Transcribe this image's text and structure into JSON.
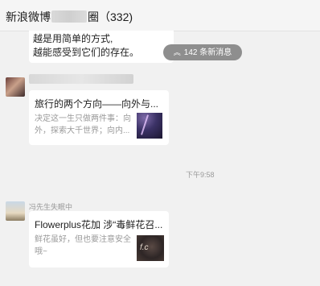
{
  "header": {
    "title_prefix": "新浪微博",
    "title_suffix": "圈（332)"
  },
  "previous_message": {
    "line1": "越是用简单的方式,",
    "line2": "越能感受到它们的存在。"
  },
  "new_messages": {
    "icon": "double-chevron-up-icon",
    "label": "142 条新消息"
  },
  "messages": [
    {
      "card_title": "旅行的两个方向——向外与...",
      "card_desc": [
        "决定这一生只做两件事：向",
        "外，探索大千世界；向内..."
      ]
    },
    {
      "sender": "冯先生失眠中",
      "card_title": "Flowerplus花加 涉“毒鲜花召...",
      "card_desc": [
        "鲜花虽好，但也要注意安全",
        "哦~"
      ]
    }
  ],
  "timestamp": "下午9:58"
}
